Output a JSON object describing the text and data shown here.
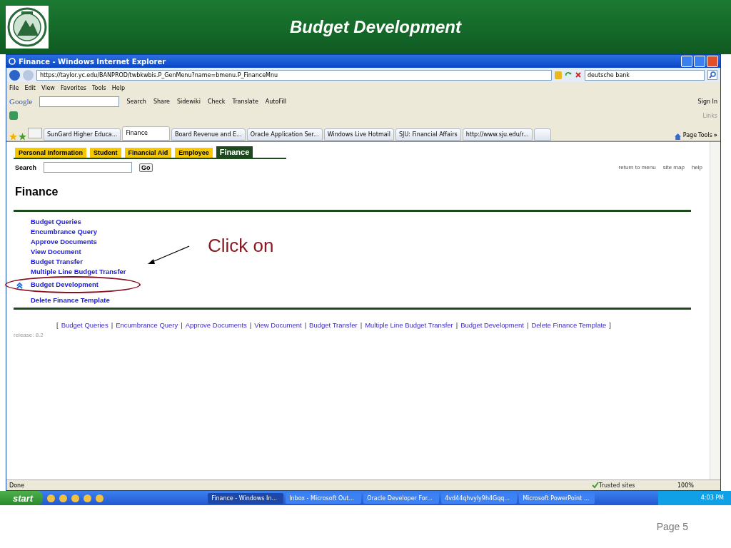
{
  "slide": {
    "title": "Budget Development",
    "page": "Page 5"
  },
  "browser": {
    "title": "Finance - Windows Internet Explorer",
    "address": "https://taylor.yc.edu/BANPROD/twbkwbis.P_GenMenu?name=bmenu.P_FinanceMnu",
    "search_value": "deutsche bank",
    "menu": [
      "File",
      "Edit",
      "View",
      "Favorites",
      "Tools",
      "Help"
    ],
    "google_label": "Google",
    "google_tools": [
      "Search",
      "Share",
      "Sidewiki",
      "Check",
      "Translate",
      "AutoFill"
    ],
    "sign_in": "Sign In",
    "links": "Links",
    "tabs": [
      {
        "label": "SunGard Higher Educa...",
        "selected": false
      },
      {
        "label": "Finance",
        "selected": true
      },
      {
        "label": "Board Revenue and E...",
        "selected": false
      },
      {
        "label": "Oracle Application Ser...",
        "selected": false
      },
      {
        "label": "Windows Live Hotmail",
        "selected": false
      },
      {
        "label": "SJU: Financial Affairs",
        "selected": false
      },
      {
        "label": "http://www.sju.edu/r...",
        "selected": false
      }
    ],
    "commands": [
      "Page",
      "Tools"
    ],
    "more": "»"
  },
  "page": {
    "nav_tabs": [
      {
        "label": "Personal Information",
        "selected": false
      },
      {
        "label": "Student",
        "selected": false
      },
      {
        "label": "Financial Aid",
        "selected": false
      },
      {
        "label": "Employee",
        "selected": false
      },
      {
        "label": "Finance",
        "selected": true
      }
    ],
    "search_label": "Search",
    "go": "Go",
    "top_links": [
      "return to menu",
      "site map",
      "help"
    ],
    "heading": "Finance",
    "menu_items": [
      {
        "label": "Budget Queries",
        "highlighted": false
      },
      {
        "label": "Encumbrance Query",
        "highlighted": false
      },
      {
        "label": "Approve Documents",
        "highlighted": false
      },
      {
        "label": "View Document",
        "highlighted": false
      },
      {
        "label": "Budget Transfer",
        "highlighted": false
      },
      {
        "label": "Multiple Line Budget Transfer",
        "highlighted": false
      },
      {
        "label": "Budget Development",
        "highlighted": true
      },
      {
        "label": "Delete Finance Template",
        "highlighted": false
      }
    ],
    "annotation": "Click on",
    "footer_links": [
      "Budget Queries",
      "Encumbrance Query",
      "Approve Documents",
      "View Document",
      "Budget Transfer",
      "Multiple Line Budget Transfer",
      "Budget Development",
      "Delete Finance Template"
    ],
    "bracket_open": "[",
    "bracket_close": "]",
    "separator": "|",
    "release": "release: 8.2"
  },
  "status": {
    "text": "Done",
    "zone": "Trusted sites",
    "zoom": "100%"
  },
  "taskbar": {
    "start": "start",
    "windows": [
      {
        "label": "Finance - Windows In...",
        "selected": true
      },
      {
        "label": "Inbox - Microsoft Out...",
        "selected": false
      },
      {
        "label": "Oracle Developer For...",
        "selected": false
      },
      {
        "label": "4vd44qhvyly9h4Gqq...",
        "selected": false
      },
      {
        "label": "Microsoft PowerPoint ...",
        "selected": false
      }
    ],
    "clock": "4:03 PM"
  }
}
